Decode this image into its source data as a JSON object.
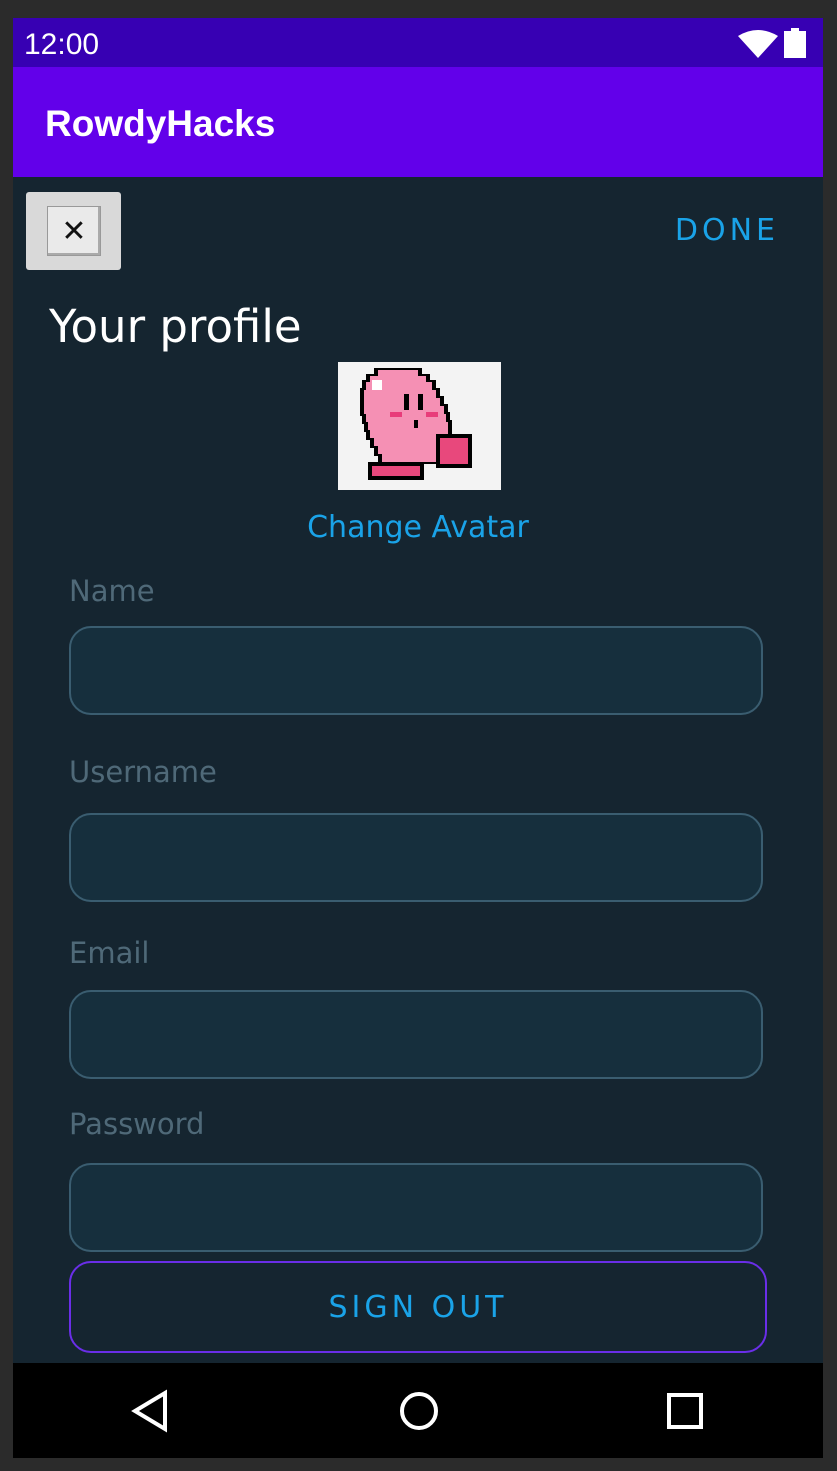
{
  "status_bar": {
    "time": "12:00"
  },
  "app_bar": {
    "title": "RowdyHacks"
  },
  "toolbar": {
    "close_label": "✕",
    "done_label": "DONE"
  },
  "profile": {
    "title": "Your profile",
    "change_avatar_label": "Change Avatar",
    "fields": [
      {
        "label": "Name",
        "value": ""
      },
      {
        "label": "Username",
        "value": ""
      },
      {
        "label": "Email",
        "value": ""
      },
      {
        "label": "Password",
        "value": ""
      }
    ],
    "sign_out_label": "SIGN OUT"
  },
  "colors": {
    "status_bar": "#3700b3",
    "app_bar": "#6200ea",
    "background": "#152530",
    "accent": "#1aa3e8",
    "input_border": "#3a5d70",
    "sign_out_border": "#6a2ee8"
  },
  "icons": {
    "status": [
      "wifi-icon",
      "battery-icon"
    ],
    "nav": [
      "back-icon",
      "home-icon",
      "recents-icon"
    ]
  }
}
